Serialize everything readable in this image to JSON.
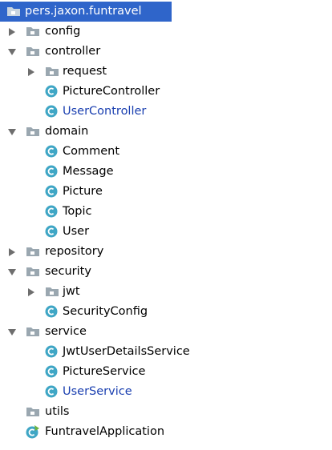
{
  "tree": {
    "root": {
      "label": "pers.jaxon.funtravel",
      "icon": "package-folder-icon"
    },
    "items": [
      {
        "label": "config",
        "type": "package",
        "expanded": false
      },
      {
        "label": "controller",
        "type": "package",
        "expanded": true
      },
      {
        "label": "request",
        "type": "package",
        "expanded": false
      },
      {
        "label": "PictureController",
        "type": "class"
      },
      {
        "label": "UserController",
        "type": "class",
        "color": "#1a3fb0"
      },
      {
        "label": "domain",
        "type": "package",
        "expanded": true
      },
      {
        "label": "Comment",
        "type": "class"
      },
      {
        "label": "Message",
        "type": "class"
      },
      {
        "label": "Picture",
        "type": "class"
      },
      {
        "label": "Topic",
        "type": "class"
      },
      {
        "label": "User",
        "type": "class"
      },
      {
        "label": "repository",
        "type": "package",
        "expanded": false
      },
      {
        "label": "security",
        "type": "package",
        "expanded": true
      },
      {
        "label": "jwt",
        "type": "package",
        "expanded": false
      },
      {
        "label": "SecurityConfig",
        "type": "class"
      },
      {
        "label": "service",
        "type": "package",
        "expanded": true
      },
      {
        "label": "JwtUserDetailsService",
        "type": "class"
      },
      {
        "label": "PictureService",
        "type": "class"
      },
      {
        "label": "UserService",
        "type": "class",
        "color": "#1a3fb0"
      },
      {
        "label": "utils",
        "type": "package"
      },
      {
        "label": "FuntravelApplication",
        "type": "spring-boot-class"
      }
    ]
  },
  "colors": {
    "selection": "#2f65ca",
    "modified_file_text": "#1a3fb0",
    "class_icon": "#3fa6c5",
    "folder_icon": "#9aa7b0"
  }
}
